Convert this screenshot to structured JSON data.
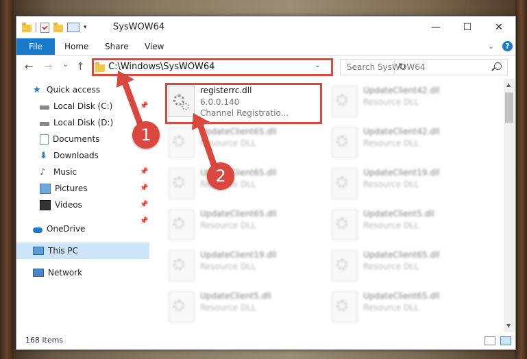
{
  "window": {
    "title": "SysWOW64",
    "controls": {
      "minimize": "—",
      "maximize": "☐",
      "close": "✕"
    }
  },
  "ribbon": {
    "tabs": [
      "File",
      "Home",
      "Share",
      "View"
    ],
    "collapse_icon": "chevron-down-icon",
    "help_label": "?"
  },
  "navigation": {
    "back": "←",
    "forward": "→",
    "recent": "⌄",
    "up": "↑",
    "address": "C:\\Windows\\SysWOW64",
    "search_placeholder": "Search SysWOW64"
  },
  "sidebar": {
    "items": [
      {
        "label": "Quick access",
        "icon": "star-icon"
      },
      {
        "label": "Local Disk (C:)",
        "icon": "drive-icon"
      },
      {
        "label": "Local Disk (D:)",
        "icon": "drive-icon"
      },
      {
        "label": "Documents",
        "icon": "documents-icon"
      },
      {
        "label": "Downloads",
        "icon": "download-icon"
      },
      {
        "label": "Music",
        "icon": "music-icon"
      },
      {
        "label": "Pictures",
        "icon": "pictures-icon"
      },
      {
        "label": "Videos",
        "icon": "video-icon"
      },
      {
        "label": "OneDrive",
        "icon": "cloud-icon"
      },
      {
        "label": "This PC",
        "icon": "monitor-icon"
      },
      {
        "label": "Network",
        "icon": "network-icon"
      }
    ],
    "pin": "📌"
  },
  "files": {
    "highlighted": {
      "name": "registerrc.dll",
      "version": "6.0.0.140",
      "description": "Channel Registratio..."
    },
    "col1": [
      {
        "name": "UpdateClient65.dll",
        "type": "Resource DLL"
      },
      {
        "name": "UpdateClient65.dll",
        "type": "Resource DLL"
      },
      {
        "name": "UpdateClient65.dll",
        "type": "Resource DLL"
      },
      {
        "name": "UpdateClient19.dll",
        "type": "Resource DLL"
      },
      {
        "name": "UpdateClient5.dll",
        "type": "Resource DLL"
      }
    ],
    "col2": [
      {
        "name": "UpdateClient42.dll",
        "type": "Resource DLL"
      },
      {
        "name": "UpdateClient42.dll",
        "type": "Resource DLL"
      },
      {
        "name": "UpdateClient19.dll",
        "type": "Resource DLL"
      },
      {
        "name": "UpdateClient5.dll",
        "type": "Resource DLL"
      },
      {
        "name": "UpdateClient65.dll",
        "type": "Resource DLL"
      },
      {
        "name": "UpdateClient65.dll",
        "type": "Resource DLL"
      }
    ]
  },
  "status": {
    "items": "168 items"
  },
  "annotations": {
    "step1": "1",
    "step2": "2",
    "color": "#d9473f"
  }
}
